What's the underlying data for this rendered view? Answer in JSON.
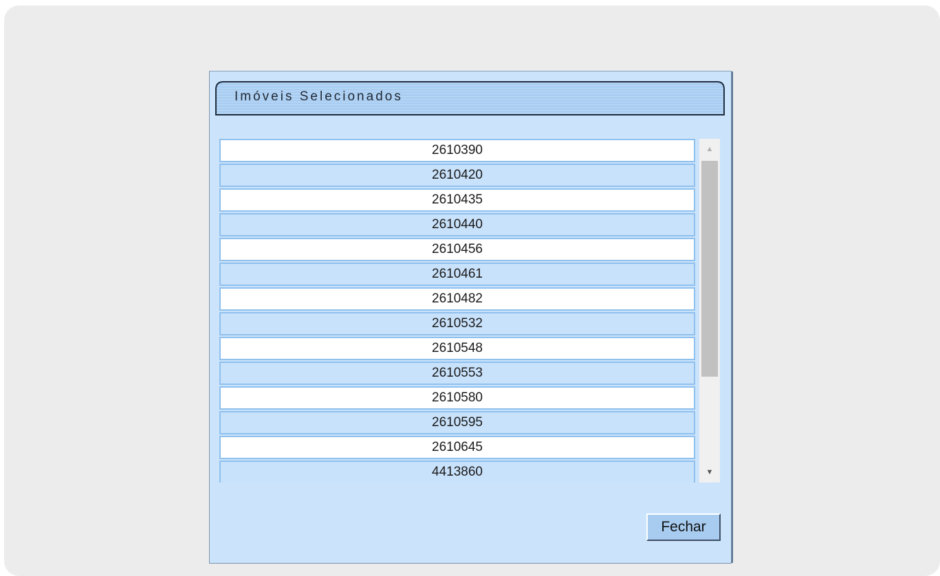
{
  "dialog": {
    "title": "Imóveis Selecionados",
    "close_label": "Fechar"
  },
  "list": {
    "items": [
      "2610390",
      "2610420",
      "2610435",
      "2610440",
      "2610456",
      "2610461",
      "2610482",
      "2610532",
      "2610548",
      "2610553",
      "2610580",
      "2610595",
      "2610645",
      "4413860"
    ]
  },
  "scrollbar": {
    "up_icon": "▲",
    "down_icon": "▼"
  },
  "colors": {
    "panel_bg": "#cbe4fb",
    "row_even": "#c9e2fb",
    "row_odd": "#ffffff",
    "row_border": "#8fc0ee",
    "button_bg": "#a7ccf0"
  }
}
